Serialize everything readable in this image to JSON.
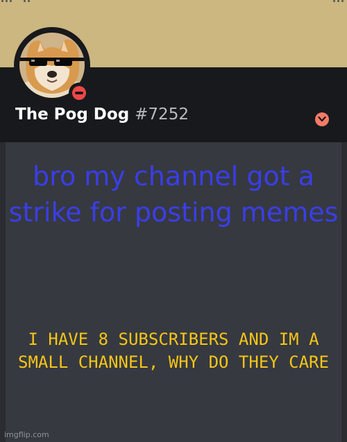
{
  "profile": {
    "username": "The Pog Dog",
    "discriminator": "#7252",
    "status": "do-not-disturb",
    "avatar_icon": "sunglasses-doge-avatar",
    "expand_icon": "chevron-down-icon"
  },
  "meme": {
    "headline": "bro my channel got a strike for posting memes",
    "subtext": "I HAVE 8 SUBSCRIBERS AND IM A SMALL CHANNEL, WHY DO THEY CARE"
  },
  "watermark": "imgflip.com",
  "colors": {
    "banner": "#cbb77f",
    "profile_background": "#18191c",
    "content_background": "#36393f",
    "status_dnd": "#f04747",
    "headline_text": "#3a3ee8",
    "subtext_text": "#f5c518"
  }
}
